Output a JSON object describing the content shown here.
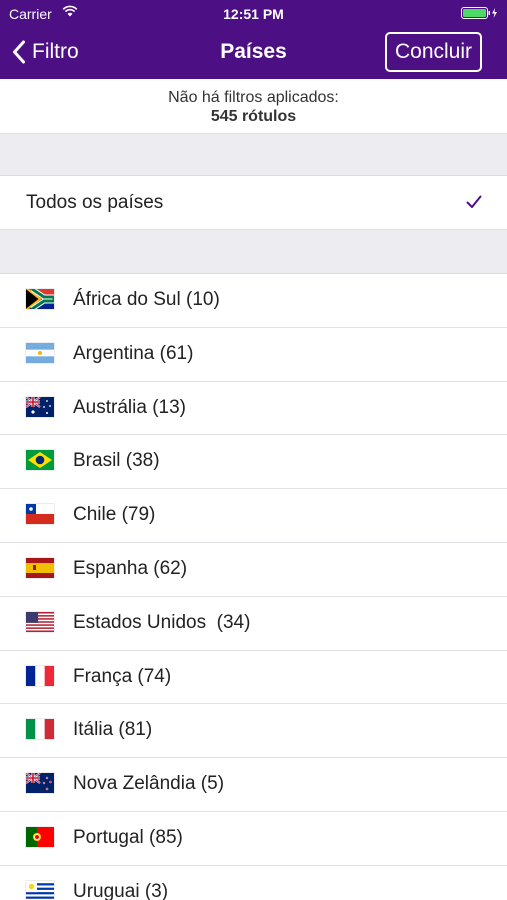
{
  "status_bar": {
    "carrier": "Carrier",
    "time": "12:51 PM"
  },
  "nav": {
    "back_label": "Filtro",
    "title": "Países",
    "done_label": "Concluir"
  },
  "info": {
    "line1": "Não há filtros aplicados:",
    "line2": "545 rótulos"
  },
  "all_countries": {
    "label": "Todos os países",
    "selected": true
  },
  "accent_color": "#4d0f84",
  "countries": [
    {
      "label": "África do Sul (10)",
      "flag": "south-africa"
    },
    {
      "label": "Argentina (61)",
      "flag": "argentina"
    },
    {
      "label": "Austrália (13)",
      "flag": "australia"
    },
    {
      "label": "Brasil (38)",
      "flag": "brazil"
    },
    {
      "label": "Chile (79)",
      "flag": "chile"
    },
    {
      "label": "Espanha (62)",
      "flag": "spain"
    },
    {
      "label": "Estados Unidos  (34)",
      "flag": "usa"
    },
    {
      "label": "França (74)",
      "flag": "france"
    },
    {
      "label": "Itália (81)",
      "flag": "italy"
    },
    {
      "label": "Nova Zelândia (5)",
      "flag": "new-zealand"
    },
    {
      "label": "Portugal (85)",
      "flag": "portugal"
    },
    {
      "label": "Uruguai (3)",
      "flag": "uruguay"
    }
  ]
}
